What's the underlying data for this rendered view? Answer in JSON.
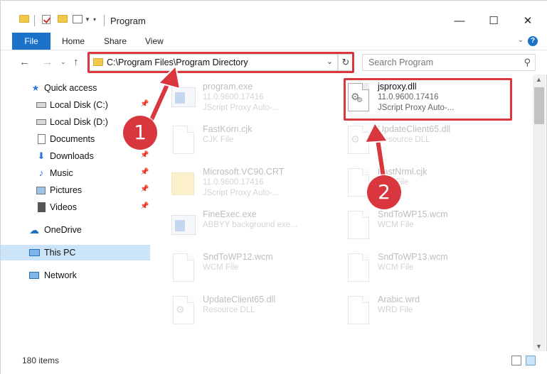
{
  "window": {
    "title": "Program",
    "controls": {
      "minimize": "—",
      "maximize": "☐",
      "close": "✕"
    }
  },
  "ribbon": {
    "file_tab": "File",
    "tabs": [
      "Home",
      "Share",
      "View"
    ]
  },
  "address_bar": {
    "path": "C:\\Program Files\\Program Directory",
    "refresh_glyph": "↻"
  },
  "search": {
    "placeholder": "Search Program",
    "icon": "search-icon"
  },
  "sidebar": {
    "items": [
      {
        "label": "Quick access",
        "icon": "star-icon"
      },
      {
        "label": "Local Disk (C:)",
        "icon": "drive-icon",
        "pinned": true
      },
      {
        "label": "Local Disk (D:)",
        "icon": "drive-icon"
      },
      {
        "label": "Documents",
        "icon": "documents-icon",
        "pinned": true
      },
      {
        "label": "Downloads",
        "icon": "downloads-icon",
        "pinned": true
      },
      {
        "label": "Music",
        "icon": "music-icon",
        "pinned": true
      },
      {
        "label": "Pictures",
        "icon": "pictures-icon",
        "pinned": true
      },
      {
        "label": "Videos",
        "icon": "videos-icon",
        "pinned": true
      },
      {
        "label": "OneDrive",
        "icon": "onedrive-icon"
      },
      {
        "label": "This PC",
        "icon": "computer-icon",
        "selected": true
      },
      {
        "label": "Network",
        "icon": "network-icon"
      }
    ]
  },
  "files": [
    {
      "name": "program.exe",
      "line2": "11.0.9600.17416",
      "line3": "JScript Proxy Auto-...",
      "icon": "exe-icon"
    },
    {
      "name": "jsproxy.dll",
      "line2": "11.0.9600.17416",
      "line3": "JScript Proxy Auto-...",
      "icon": "dll-icon",
      "highlighted": true
    },
    {
      "name": "FastKorn.cjk",
      "line2": "CJK File",
      "icon": "file-icon"
    },
    {
      "name": "UpdateClient65.dll",
      "line2": "Resource DLL",
      "icon": "dll-icon"
    },
    {
      "name": "Microsoft.VC90.CRT",
      "line2": "11.0.9600.17416",
      "line3": "JScript Proxy Auto-...",
      "icon": "folder-icon"
    },
    {
      "name": "FastNrml.cjk",
      "line2": "CJK File",
      "icon": "file-icon"
    },
    {
      "name": "FineExec.exe",
      "line2": "ABBYY background exe...",
      "icon": "exe-icon"
    },
    {
      "name": "SndToWP15.wcm",
      "line2": "WCM File",
      "icon": "file-icon"
    },
    {
      "name": "SndToWP12.wcm",
      "line2": "WCM File",
      "icon": "file-icon"
    },
    {
      "name": "SndToWP13.wcm",
      "line2": "WCM File",
      "icon": "file-icon"
    },
    {
      "name": "UpdateClient65.dll",
      "line2": "Resource DLL",
      "icon": "dll-icon"
    },
    {
      "name": "Arabic.wrd",
      "line2": "WRD File",
      "icon": "file-icon"
    }
  ],
  "annotations": {
    "step1": "1",
    "step2": "2",
    "highlight_color": "#d9363e"
  },
  "status_bar": {
    "item_count": "180 items"
  },
  "colors": {
    "accent": "#1a73c8",
    "selected_bg": "#cce4f7",
    "folder": "#f3c94a"
  }
}
